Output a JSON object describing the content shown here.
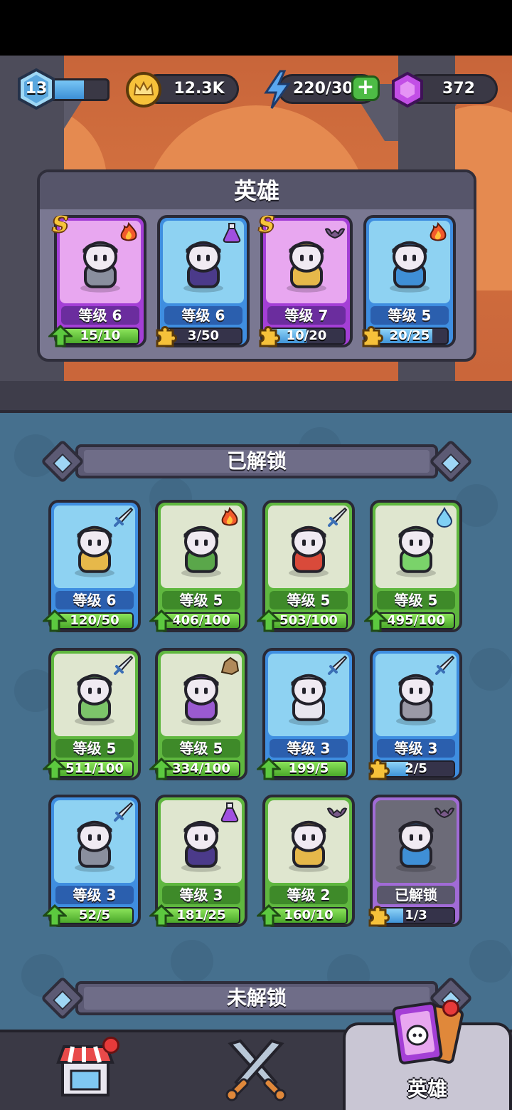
{
  "topbar": {
    "player_level": "13",
    "xp_fraction": 0.62,
    "gold": "12.3K",
    "energy": "220/30",
    "gems": "372"
  },
  "hero_panel": {
    "title": "英雄",
    "cards": [
      {
        "rank": "S",
        "level": "等级 6",
        "progress": "15/10",
        "fill": 1.0,
        "frame": "purple",
        "element": "fire-icon",
        "marker": "up"
      },
      {
        "rank": "",
        "level": "等级 6",
        "progress": "3/50",
        "fill": 0.06,
        "frame": "blue",
        "element": "potion-icon",
        "marker": "puzzle"
      },
      {
        "rank": "S",
        "level": "等级 7",
        "progress": "10/20",
        "fill": 0.5,
        "frame": "purple",
        "element": "bat-icon",
        "marker": "puzzle"
      },
      {
        "rank": "",
        "level": "等级 5",
        "progress": "20/25",
        "fill": 0.8,
        "frame": "blue",
        "element": "fire-icon",
        "marker": "puzzle"
      }
    ]
  },
  "unlocked": {
    "title": "已解锁",
    "cards": [
      {
        "level": "等级 6",
        "progress": "120/50",
        "fill": 1.0,
        "frame": "blue",
        "element": "sword-icon",
        "marker": "up"
      },
      {
        "level": "等级 5",
        "progress": "406/100",
        "fill": 1.0,
        "frame": "green",
        "element": "fire-icon",
        "marker": "up"
      },
      {
        "level": "等级 5",
        "progress": "503/100",
        "fill": 1.0,
        "frame": "green",
        "element": "sword-icon",
        "marker": "up"
      },
      {
        "level": "等级 5",
        "progress": "495/100",
        "fill": 1.0,
        "frame": "green",
        "element": "water-icon",
        "marker": "up"
      },
      {
        "level": "等级 5",
        "progress": "511/100",
        "fill": 1.0,
        "frame": "green",
        "element": "sword-icon",
        "marker": "up"
      },
      {
        "level": "等级 5",
        "progress": "334/100",
        "fill": 1.0,
        "frame": "green",
        "element": "rock-icon",
        "marker": "up"
      },
      {
        "level": "等级 3",
        "progress": "199/5",
        "fill": 1.0,
        "frame": "blue",
        "element": "sword-icon",
        "marker": "up"
      },
      {
        "level": "等级 3",
        "progress": "2/5",
        "fill": 0.4,
        "frame": "blue",
        "element": "sword-icon",
        "marker": "puzzle"
      },
      {
        "level": "等级 3",
        "progress": "52/5",
        "fill": 1.0,
        "frame": "blue",
        "element": "sword-icon",
        "marker": "up"
      },
      {
        "level": "等级 3",
        "progress": "181/25",
        "fill": 1.0,
        "frame": "green",
        "element": "potion-icon",
        "marker": "up"
      },
      {
        "level": "等级 2",
        "progress": "160/10",
        "fill": 1.0,
        "frame": "green",
        "element": "bat-icon",
        "marker": "up"
      },
      {
        "level": "已解锁",
        "progress": "1/3",
        "fill": 0.33,
        "frame": "gray",
        "element": "bat-icon",
        "marker": "puzzle"
      }
    ]
  },
  "locked": {
    "title": "未解锁"
  },
  "nav": {
    "hero_label": "英雄",
    "colors": {
      "active_tab": "#c9c6d4",
      "bar": "#3a3945"
    }
  }
}
